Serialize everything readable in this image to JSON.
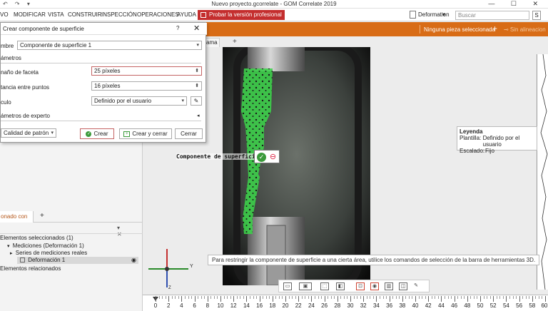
{
  "window": {
    "title": "Nuevo proyecto.gcorrelate - GOM Correlate 2019",
    "controls": "— ☐ ✕",
    "quick_access": "↶ ↷ ▾"
  },
  "menu": {
    "items": [
      "VO",
      "MODIFICAR",
      "VISTA",
      "CONSTRUIR",
      "INSPECCIÓN",
      "OPERACIONES",
      "AYUDA"
    ],
    "promo": "Probar la versión profesional",
    "workspace": "Deformation",
    "workspace_arrow": "▾",
    "help_icon": "?",
    "search_placeholder": "Buscar",
    "search_btn": "S"
  },
  "orangebar": {
    "selection": "Ninguna pieza seleccionada",
    "plus": "+",
    "alignments": "⊸ Sin alineacion"
  },
  "dialog": {
    "title": "Crear componente de superficie",
    "help": "?",
    "close": "✕",
    "name_label": "mbre",
    "name_value": "Componente de superficie 1",
    "params_section": "ámetros",
    "facet_label": "naño de faceta",
    "facet_value": "25 píxeles",
    "distance_label": "tancia entre puntos",
    "distance_value": "16 píxeles",
    "calc_label": "culo",
    "calc_value": "Definido por el usuario",
    "expert_section": "ámetros de experto",
    "quality_value": "Calidad de patrón",
    "btn_create": "Crear",
    "btn_create_close": "Crear y cerrar",
    "btn_close": "Cerrar"
  },
  "viewport": {
    "tab1": "ama",
    "tab_plus": "+",
    "component_label": "Componente de superficie 1",
    "ok_symbol": "✓",
    "minus_symbol": "⊖",
    "legend": {
      "title": "Leyenda",
      "template_label": "Plantilla:",
      "template_value": "Definido por el usuario",
      "scale_label": "Escalado:",
      "scale_value": "Fijo"
    },
    "hint": "Para restringir la componente de superficie a una cierta área, utilice los comandos de selección de la barra de herramientas 3D.",
    "axis_x": "X",
    "axis_y": "Y",
    "axis_z": "Z"
  },
  "toolbar3d": [
    "▭",
    "▣",
    "⬚",
    "◧",
    "⊡",
    "◉",
    "▥",
    "◫",
    "⊠",
    "✎"
  ],
  "timeline": {
    "ticks": [
      "0",
      "2",
      "4",
      "6",
      "8",
      "10",
      "12",
      "14",
      "16",
      "18",
      "20",
      "22",
      "24",
      "26",
      "28",
      "30",
      "32",
      "34",
      "36",
      "38",
      "40",
      "42",
      "44",
      "46",
      "48",
      "50",
      "52",
      "54",
      "56",
      "58",
      "60."
    ]
  },
  "leftpanel": {
    "tab": "onado con",
    "tab_plus": "+",
    "ctrl": "▾ ✕",
    "tree": {
      "selected_header": "Elementos seleccionados (1)",
      "item1": "Mediciones (Deformación 1)",
      "item2": "Series de mediciones reales",
      "item3": "Deformación 1",
      "related_header": "Elementos relacionados"
    }
  },
  "colors": {
    "accent_orange": "#d86c16",
    "promo_red": "#c42e2e",
    "facet_green": "#3cd24a"
  }
}
